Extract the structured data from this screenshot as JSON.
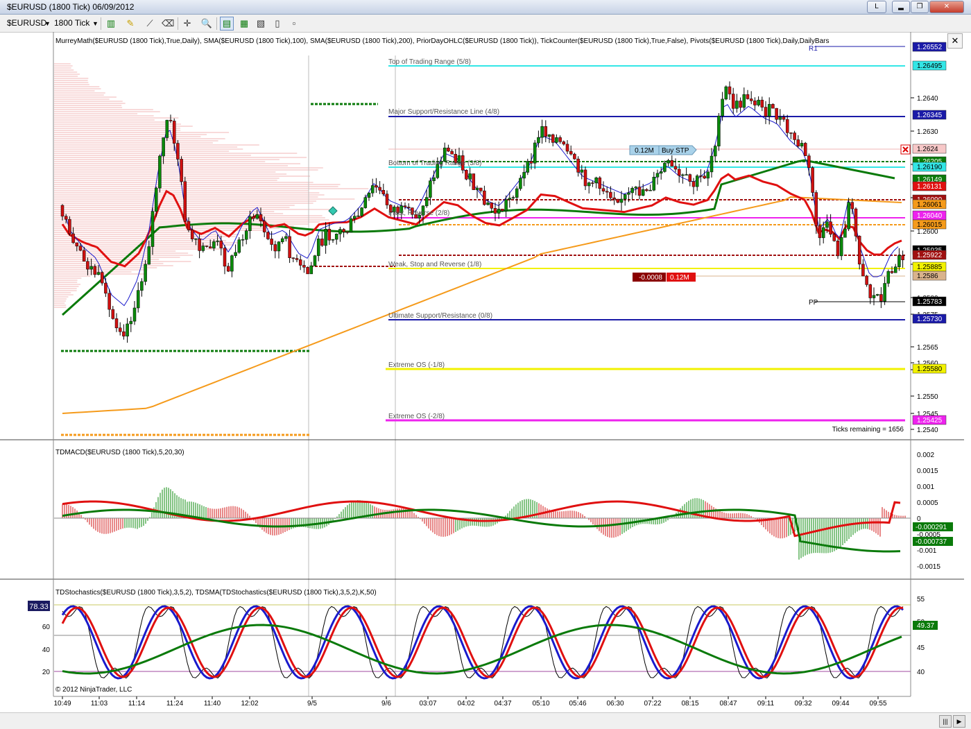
{
  "window": {
    "title": "$EURUSD (1800 Tick)  06/09/2012",
    "btn_l": "L",
    "btn_min": "▂",
    "btn_max": "❐",
    "btn_close": "✕"
  },
  "toolbar": {
    "instrument": "$EURUSD",
    "interval": "1800 Tick"
  },
  "main_panel": {
    "indicators_label": "MurreyMath($EURUSD (1800 Tick),True,Daily), SMA($EURUSD (1800 Tick),100), SMA($EURUSD (1800 Tick),200), PriorDayOHLC($EURUSD (1800 Tick)), TickCounter($EURUSD (1800 Tick),True,False), Pivots($EURUSD (1800 Tick),Daily,DailyBars",
    "murrey_labels": [
      "Top of Trading Range (5/8)",
      "Major Support/Resistance Line (4/8)",
      "Bottom of Trading Range (3/8)",
      "Pivot, Reverse (2/8)",
      "Weak, Stop and Reverse (1/8)",
      "Ultimate Support/Resistance (0/8)",
      "Extreme OS (-1/8)",
      "Extreme OS (-2/8)"
    ],
    "pivot_r1": "R1",
    "pivot_pp": "PP",
    "ticks_remaining": "Ticks remaining = 1656",
    "order_buy_size": "0.12M",
    "order_buy_type": "Buy STP",
    "position_pnl": "-0.0008",
    "position_size": "0.12M",
    "price_axis_ticks": [
      "1.2640",
      "1.2630",
      "1.2620",
      "1.2610",
      "1.2600",
      "1.2590",
      "1.2580",
      "1.2575",
      "1.2565",
      "1.2560",
      "1.2555",
      "1.2550",
      "1.2545",
      "1.2540"
    ],
    "price_markers": [
      {
        "label": "1.26552",
        "bg": "#1a1aa8",
        "fg": "#ffffff"
      },
      {
        "label": "1.26495",
        "bg": "#33e6e6",
        "fg": "#000000"
      },
      {
        "label": "1.26345",
        "bg": "#1a1aa8",
        "fg": "#ffffff"
      },
      {
        "label": "1.2624",
        "bg": "#f7c8c8",
        "fg": "#000000"
      },
      {
        "label": "1.26205",
        "bg": "#0a7a0a",
        "fg": "#ffffff"
      },
      {
        "label": "1.26190",
        "bg": "#33e6e6",
        "fg": "#000000"
      },
      {
        "label": "1.26149",
        "bg": "#0a7a0a",
        "fg": "#ffffff"
      },
      {
        "label": "1.26131",
        "bg": "#e01010",
        "fg": "#ffffff"
      },
      {
        "label": "1.26090",
        "bg": "#a01010",
        "fg": "#ffffff"
      },
      {
        "label": "1.26061",
        "bg": "#f59a1a",
        "fg": "#000000"
      },
      {
        "label": "1.26040",
        "bg": "#ee22ee",
        "fg": "#ffffff"
      },
      {
        "label": "1.26015",
        "bg": "#f59a1a",
        "fg": "#000000"
      },
      {
        "label": "1.25935",
        "bg": "#000000",
        "fg": "#ffffff"
      },
      {
        "label": "1.25922",
        "bg": "#a01010",
        "fg": "#ffffff"
      },
      {
        "label": "1.25885",
        "bg": "#f2f200",
        "fg": "#000000"
      },
      {
        "label": "1.2586",
        "bg": "#d9b38c",
        "fg": "#000000"
      },
      {
        "label": "1.25783",
        "bg": "#000000",
        "fg": "#ffffff"
      },
      {
        "label": "1.25730",
        "bg": "#1a1aa8",
        "fg": "#ffffff"
      },
      {
        "label": "1.25580",
        "bg": "#f2f200",
        "fg": "#000000"
      },
      {
        "label": "1.25425",
        "bg": "#ee22ee",
        "fg": "#ffffff"
      }
    ]
  },
  "macd_panel": {
    "label": "TDMACD($EURUSD (1800 Tick),5,20,30)",
    "axis_ticks": [
      "0.002",
      "0.0015",
      "0.001",
      "0.0005",
      "0",
      "-0.0005",
      "-0.001",
      "-0.0015"
    ],
    "markers": [
      {
        "label": "-0.000291",
        "bg": "#0a7a0a",
        "fg": "#ffffff"
      },
      {
        "label": "-0.000737",
        "bg": "#0a7a0a",
        "fg": "#ffffff"
      }
    ]
  },
  "stoch_panel": {
    "label": "TDStochastics($EURUSD (1800 Tick),3,5,2), TDSMA(TDStochastics($EURUSD (1800 Tick),3,5,2),K,50)",
    "left_value": "78.33",
    "left_ticks": [
      "60",
      "40",
      "20"
    ],
    "right_ticks": [
      "55",
      "50",
      "45",
      "40"
    ],
    "right_marker": "49.37",
    "copyright": "© 2012 NinjaTrader, LLC"
  },
  "time_axis": [
    "10:49",
    "11:03",
    "11:14",
    "11:24",
    "11:40",
    "12:02",
    "9/5",
    "9/6",
    "03:07",
    "04:02",
    "04:37",
    "05:10",
    "05:46",
    "06:30",
    "07:22",
    "08:15",
    "08:47",
    "09:11",
    "09:32",
    "09:44",
    "09:55"
  ],
  "colors": {
    "up_candle": "#0a8a0a",
    "down_candle": "#d01010",
    "sma100": "#0a7a0a",
    "sma200": "#f59a1a",
    "ema_fast": "#1a1acc",
    "profile": "#f2b6b6"
  }
}
